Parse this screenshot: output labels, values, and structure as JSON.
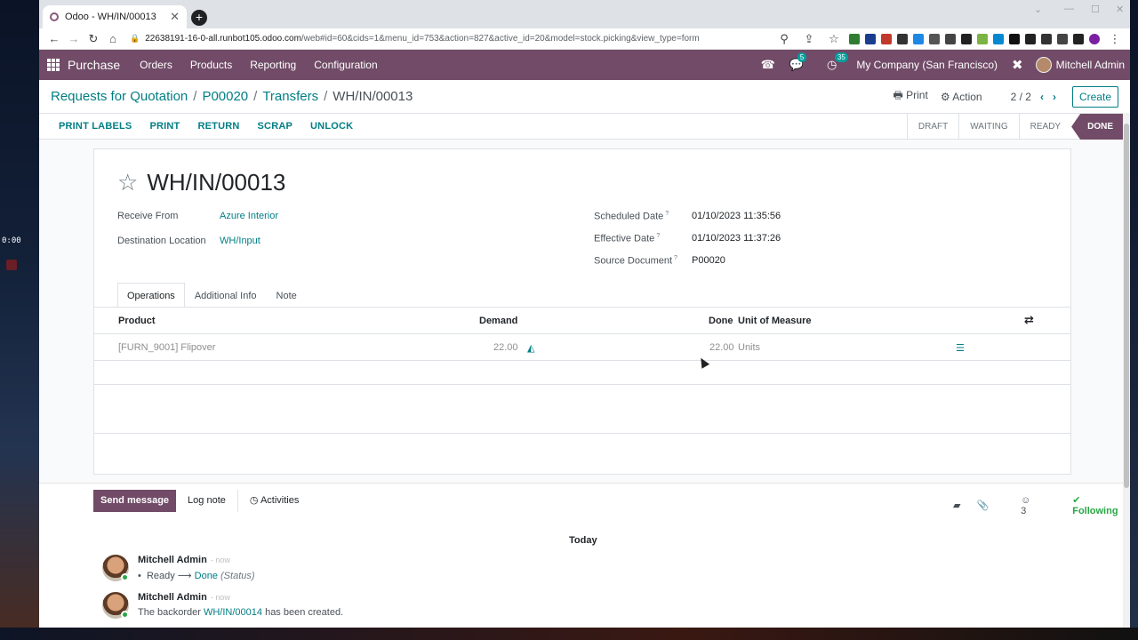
{
  "recording": {
    "time": "0:00"
  },
  "browser": {
    "tab_title": "Odoo - WH/IN/00013",
    "url_host": "22638191-16-0-all.runbot105.odoo.com",
    "url_path": "/web#id=60&cids=1&menu_id=753&action=827&active_id=20&model=stock.picking&view_type=form"
  },
  "navbar": {
    "app_name": "Purchase",
    "menu": [
      "Orders",
      "Products",
      "Reporting",
      "Configuration"
    ],
    "messages_badge": "5",
    "activities_badge": "35",
    "company": "My Company (San Francisco)",
    "user": "Mitchell Admin"
  },
  "breadcrumb": {
    "items": [
      "Requests for Quotation",
      "P00020",
      "Transfers"
    ],
    "current": "WH/IN/00013"
  },
  "control": {
    "print_label": "Print",
    "action_label": "Action",
    "pager": "2 / 2",
    "create_label": "Create"
  },
  "actions": [
    "PRINT LABELS",
    "PRINT",
    "RETURN",
    "SCRAP",
    "UNLOCK"
  ],
  "stages": [
    "DRAFT",
    "WAITING",
    "READY",
    "DONE"
  ],
  "record": {
    "name": "WH/IN/00013",
    "receive_from_label": "Receive From",
    "receive_from": "Azure Interior",
    "destination_label": "Destination Location",
    "destination": "WH/Input",
    "scheduled_label": "Scheduled Date",
    "scheduled": "01/10/2023 11:35:56",
    "effective_label": "Effective Date",
    "effective": "01/10/2023 11:37:26",
    "source_label": "Source Document",
    "source": "P00020"
  },
  "tabs": [
    "Operations",
    "Additional Info",
    "Note"
  ],
  "table": {
    "headers": {
      "product": "Product",
      "demand": "Demand",
      "done": "Done",
      "uom": "Unit of Measure"
    },
    "rows": [
      {
        "product": "[FURN_9001] Flipover",
        "demand": "22.00",
        "done": "22.00",
        "uom": "Units"
      }
    ]
  },
  "chatter": {
    "send_message": "Send message",
    "log_note": "Log note",
    "activities": "Activities",
    "followers_count": "3",
    "following": "Following",
    "day_label": "Today",
    "messages": [
      {
        "author": "Mitchell Admin",
        "when": "- now",
        "from": "Ready",
        "to": "Done",
        "field": "(Status)"
      },
      {
        "author": "Mitchell Admin",
        "when": "- now",
        "text_before": "The backorder ",
        "link": "WH/IN/00014",
        "text_after": " has been created."
      }
    ]
  },
  "colors": {
    "brand": "#714b67",
    "link": "#017e84",
    "success": "#28a745"
  }
}
